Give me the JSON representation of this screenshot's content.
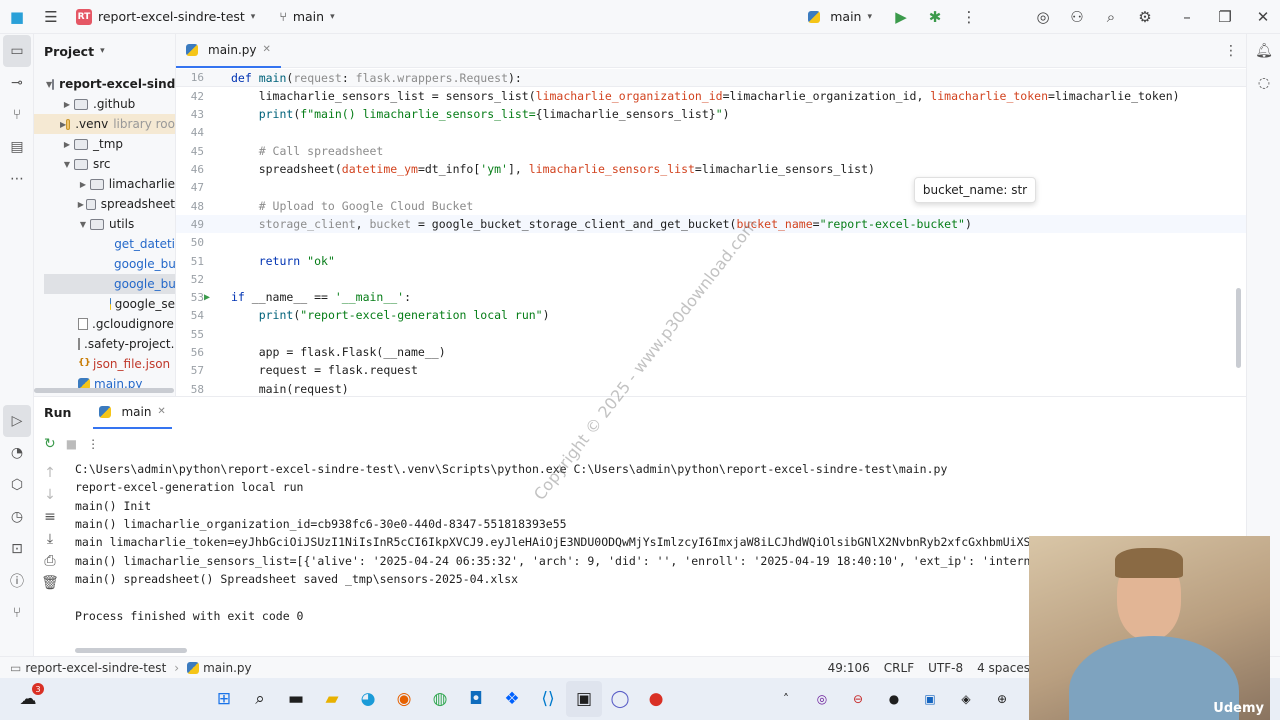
{
  "titlebar": {
    "project_badge": "RT",
    "project_name": "report-excel-sindre-test",
    "branch": "main",
    "run_config": "main"
  },
  "project_panel": {
    "title": "Project",
    "items": [
      {
        "label": "report-excel-sind"
      },
      {
        "label": ".github"
      },
      {
        "label": ".venv",
        "suffix": "library roo"
      },
      {
        "label": "_tmp"
      },
      {
        "label": "src"
      },
      {
        "label": "limacharlie"
      },
      {
        "label": "spreadsheet"
      },
      {
        "label": "utils"
      },
      {
        "label": "get_dateti"
      },
      {
        "label": "google_bu"
      },
      {
        "label": "google_bu"
      },
      {
        "label": "google_se"
      },
      {
        "label": ".gcloudignore"
      },
      {
        "label": ".safety-project.i"
      },
      {
        "label": "json_file.json"
      },
      {
        "label": "main.py"
      }
    ]
  },
  "editor": {
    "tab": "main.py",
    "warnings": "7",
    "sticky_line_number": "16",
    "sticky": "def main(request: flask.wrappers.Request):",
    "tooltip": "bucket_name: str",
    "lines": [
      {
        "n": "42",
        "text": "    limacharlie_sensors_list = sensors_list(limacharlie_organization_id=limacharlie_organization_id, limacharlie_token=limacharlie_token)"
      },
      {
        "n": "43",
        "text": "    print(f\"main() limacharlie_sensors_list={limacharlie_sensors_list}\")"
      },
      {
        "n": "44",
        "text": ""
      },
      {
        "n": "45",
        "text": "    # Call spreadsheet"
      },
      {
        "n": "46",
        "text": "    spreadsheet(datetime_ym=dt_info['ym'], limacharlie_sensors_list=limacharlie_sensors_list)"
      },
      {
        "n": "47",
        "text": ""
      },
      {
        "n": "48",
        "text": "    # Upload to Google Cloud Bucket"
      },
      {
        "n": "49",
        "text": "    storage_client, bucket = google_bucket_storage_client_and_get_bucket(bucket_name=\"report-excel-bucket\")"
      },
      {
        "n": "50",
        "text": ""
      },
      {
        "n": "51",
        "text": "    return \"ok\""
      },
      {
        "n": "52",
        "text": ""
      },
      {
        "n": "53",
        "text": "if __name__ == '__main__':"
      },
      {
        "n": "54",
        "text": "    print(\"report-excel-generation local run\")"
      },
      {
        "n": "55",
        "text": ""
      },
      {
        "n": "56",
        "text": "    app = flask.Flask(__name__)"
      },
      {
        "n": "57",
        "text": "    request = flask.request"
      },
      {
        "n": "58",
        "text": "    main(request)"
      }
    ]
  },
  "run_panel": {
    "title": "Run",
    "tab": "main",
    "output": [
      "C:\\Users\\admin\\python\\report-excel-sindre-test\\.venv\\Scripts\\python.exe C:\\Users\\admin\\python\\report-excel-sindre-test\\main.py",
      "report-excel-generation local run",
      "main() Init",
      "main() limacharlie_organization_id=cb938fc6-30e0-440d-8347-551818393e55",
      "main limacharlie_token=eyJhbGciOiJSUzI1NiIsInR5cCI6IkpXVCJ9.eyJleHAiOjE3NDU0ODQwMjYsImlzcyI6ImxjaW8iLCJhdWQiOlsibGNlX2NvbnRyb2xfcGxhbmUiXSwiaWF",
      "main() limacharlie_sensors_list=[{'alive': '2025-04-24 06:35:32', 'arch': 9, 'did': '', 'enroll': '2025-04-19 18:40:10', 'ext_ip': 'internal',",
      "main() spreadsheet() Spreadsheet saved _tmp\\sensors-2025-04.xlsx",
      "",
      "Process finished with exit code 0"
    ]
  },
  "statusbar": {
    "project": "report-excel-sindre-test",
    "file": "main.py",
    "position": "49:106",
    "line_sep": "CRLF",
    "encoding": "UTF-8",
    "indent": "4 spaces"
  },
  "taskbar": {
    "notification_count": "3"
  },
  "watermark": "Copyright © 2025 - www.p30download.com",
  "webcam_brand": "Udemy"
}
